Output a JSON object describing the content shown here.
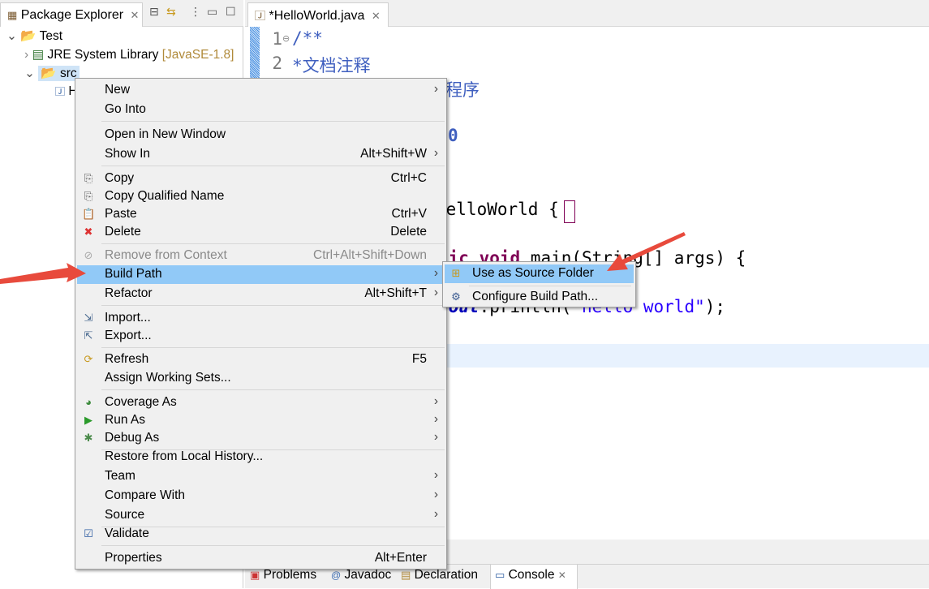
{
  "explorer": {
    "title": "Package Explorer",
    "tree": [
      {
        "label": "Test",
        "icon": "project-icon"
      },
      {
        "label": "JRE System Library",
        "decoration": "[JavaSE-1.8]",
        "icon": "library-icon"
      },
      {
        "label": "src",
        "icon": "package-folder-icon"
      },
      {
        "label": "H",
        "icon": "java-file-icon"
      }
    ]
  },
  "editor": {
    "tab": "*HelloWorld.java",
    "line_numbers": [
      "1",
      "2"
    ],
    "fragments": {
      "l1": "/**",
      "l2": "*文档注释",
      "l3": "程序",
      "l5": "0",
      "l8": "HelloWorld {",
      "l10a": "tic void",
      "l10b": " main(String[] args) {",
      "l12a": ".out",
      "l12b": ".println(",
      "l12c": "\"hello world\"",
      "l12d": ");"
    }
  },
  "bottom_tabs": [
    "Problems",
    "Javadoc",
    "Declaration",
    "Console"
  ],
  "context_menu": {
    "items": [
      {
        "label": "New",
        "submenu": true
      },
      {
        "label": "Go Into"
      },
      {
        "label": "Open in New Window"
      },
      {
        "label": "Show In",
        "shortcut": "Alt+Shift+W",
        "submenu": true
      },
      {
        "label": "Copy",
        "shortcut": "Ctrl+C",
        "icon": "copy-icon"
      },
      {
        "label": "Copy Qualified Name",
        "icon": "copy-qualified-icon"
      },
      {
        "label": "Paste",
        "shortcut": "Ctrl+V",
        "icon": "paste-icon"
      },
      {
        "label": "Delete",
        "shortcut": "Delete",
        "icon": "delete-icon"
      },
      {
        "label": "Remove from Context",
        "shortcut": "Ctrl+Alt+Shift+Down",
        "disabled": true,
        "icon": "remove-context-icon"
      },
      {
        "label": "Build Path",
        "submenu": true,
        "highlighted": true
      },
      {
        "label": "Refactor",
        "shortcut": "Alt+Shift+T",
        "submenu": true
      },
      {
        "label": "Import...",
        "icon": "import-icon"
      },
      {
        "label": "Export...",
        "icon": "export-icon"
      },
      {
        "label": "Refresh",
        "shortcut": "F5",
        "icon": "refresh-icon"
      },
      {
        "label": "Assign Working Sets..."
      },
      {
        "label": "Coverage As",
        "submenu": true,
        "icon": "coverage-icon"
      },
      {
        "label": "Run As",
        "submenu": true,
        "icon": "run-icon"
      },
      {
        "label": "Debug As",
        "submenu": true,
        "icon": "debug-icon"
      },
      {
        "label": "Restore from Local History..."
      },
      {
        "label": "Team",
        "submenu": true
      },
      {
        "label": "Compare With",
        "submenu": true
      },
      {
        "label": "Source",
        "submenu": true
      },
      {
        "label": "Validate",
        "icon": "checkbox-icon"
      },
      {
        "label": "Properties",
        "shortcut": "Alt+Enter"
      }
    ]
  },
  "submenu": {
    "items": [
      {
        "label": "Use as Source Folder",
        "highlighted": true
      },
      {
        "label": "Configure Build Path..."
      }
    ]
  },
  "colors": {
    "menu_highlight": "#91c9f7",
    "arrow": "#e84a3c",
    "selection": "#cfe4f7"
  }
}
